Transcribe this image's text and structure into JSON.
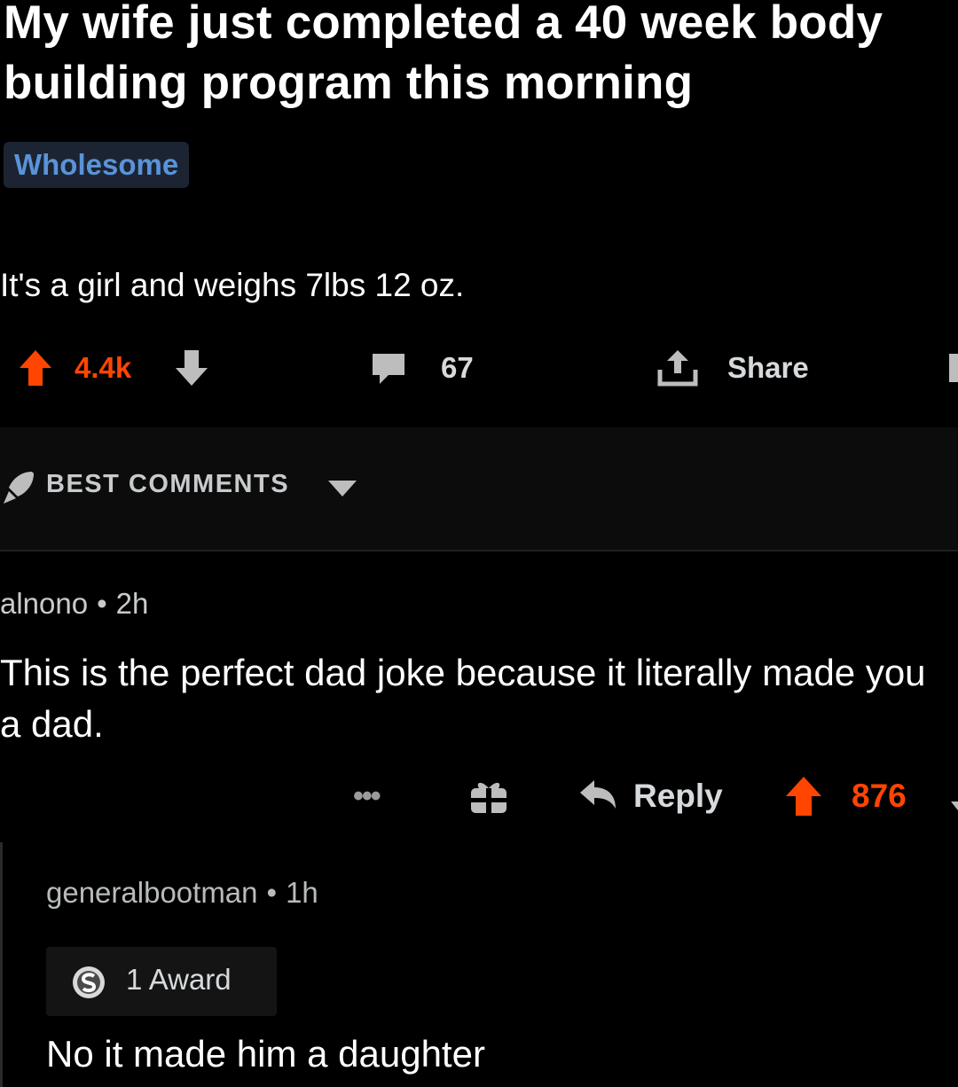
{
  "post": {
    "title": "My wife just completed a 40 week body building program this morning",
    "flair": "Wholesome",
    "body": "It's a girl and weighs 7lbs 12 oz.",
    "score": "4.4k",
    "comment_count": "67",
    "share_label": "Share"
  },
  "sort": {
    "label": "BEST COMMENTS"
  },
  "comments": [
    {
      "author": "alnono",
      "separator": "•",
      "age": "2h",
      "body": "This is the perfect dad joke because it literally made you a dad.",
      "more_label": "•••",
      "reply_label": "Reply",
      "score": "876"
    },
    {
      "author": "generalbootman",
      "separator": "•",
      "age": "1h",
      "award_label": "1 Award",
      "body": "No it made him a daughter"
    }
  ],
  "colors": {
    "upvote": "#ff4500",
    "flair_text": "#5a93d8",
    "flair_bg": "#1c2433",
    "background": "#000000"
  },
  "icons": {
    "upvote": "upvote-arrow-icon",
    "downvote": "downvote-arrow-icon",
    "comments": "comment-bubble-icon",
    "share": "share-upload-icon",
    "sort": "rocket-icon",
    "caret": "caret-down-icon",
    "gift": "gift-icon",
    "reply": "reply-arrow-icon",
    "award": "silver-award-icon"
  }
}
